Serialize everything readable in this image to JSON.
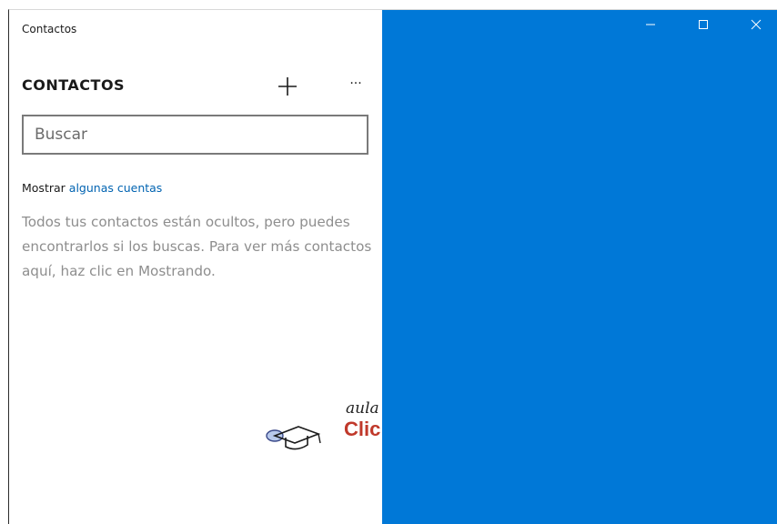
{
  "window": {
    "title": "Contactos",
    "accent_color": "#0078d7",
    "controls": {
      "minimize_icon": "minimize-icon",
      "maximize_icon": "maximize-icon",
      "close_icon": "close-icon"
    }
  },
  "header": {
    "title": "CONTACTOS",
    "add_icon": "plus-icon",
    "more_label": "···"
  },
  "search": {
    "placeholder": "Buscar",
    "value": ""
  },
  "filter": {
    "prefix": "Mostrar",
    "link": "algunas cuentas"
  },
  "empty_message": "Todos tus contactos están ocultos, pero puedes encontrarlos si los buscas. Para ver más contactos aquí, haz clic en Mostrando.",
  "watermark": {
    "top": "aula",
    "bottom": "Clic"
  }
}
